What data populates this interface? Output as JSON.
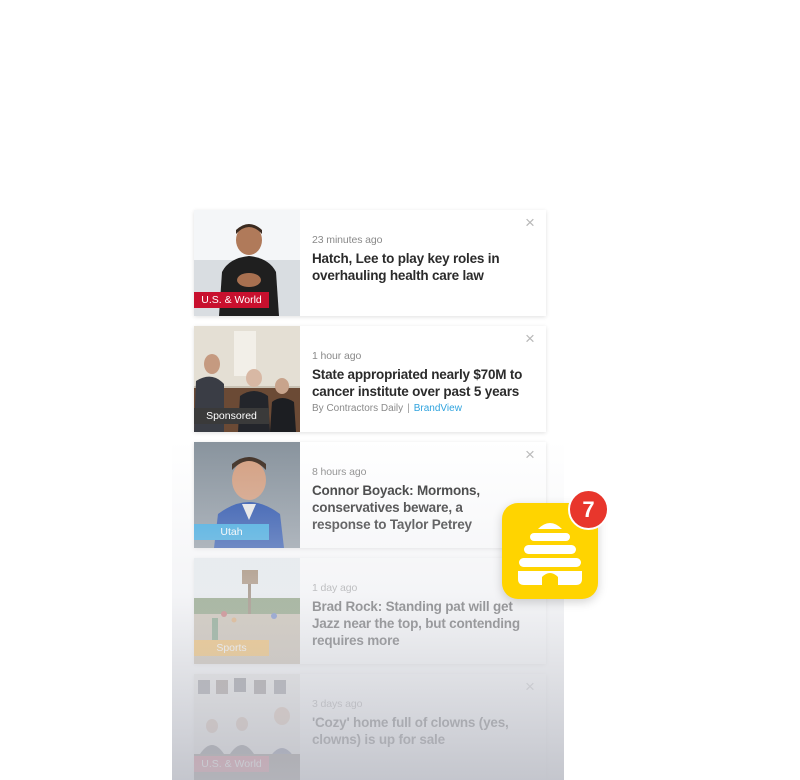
{
  "feed": {
    "items": [
      {
        "category": "U.S. & World",
        "category_color": "#c8102e",
        "time": "23 minutes ago",
        "headline": "Hatch, Lee to play key roles in overhauling health care law"
      },
      {
        "category": "Sponsored",
        "category_color": "#3a3a3a",
        "time": "1 hour ago",
        "headline": "State appropriated nearly $70M to cancer institute over past 5 years",
        "byline": "By Contractors Daily",
        "separator": "|",
        "brand": "BrandView",
        "brand_color": "#2fa3de"
      },
      {
        "category": "Utah",
        "category_color": "#2fa3de",
        "time": "8 hours ago",
        "headline": "Connor Boyack: Mormons, conservatives beware, a response to Taylor Petrey"
      },
      {
        "category": "Sports",
        "category_color": "#f5a623",
        "time": "1 day ago",
        "headline": "Brad Rock: Standing pat will get Jazz near the top, but contending requires more"
      },
      {
        "category": "U.S. & World",
        "category_color": "#c8102e",
        "time": "3 days ago",
        "headline": "'Cozy' home full of clowns (yes, clowns) is up for sale"
      }
    ],
    "close_glyph": "×"
  },
  "hive_widget": {
    "icon": "beehive-icon",
    "badge_count": "7",
    "color": "#ffd400",
    "badge_color": "#e8362c"
  }
}
